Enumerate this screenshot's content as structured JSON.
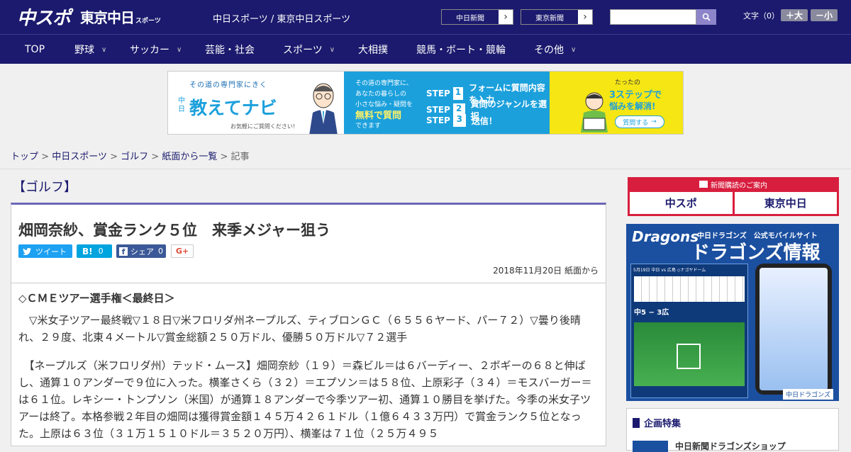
{
  "header": {
    "logo_main": "中スポ",
    "logo_sub": "東京中日",
    "logo_sub_small": "スポーツ",
    "site_title": "中日スポーツ / 東京中日スポーツ",
    "link_chunichi": "中日新聞",
    "link_tokyo": "東京新聞",
    "search_placeholder": "",
    "font_label": "文字（0）",
    "font_large": "＋大",
    "font_small": "－小"
  },
  "nav": {
    "items": [
      "TOP",
      "野球",
      "サッカー",
      "芸能・社会",
      "スポーツ",
      "大相撲",
      "競馬・ボート・競輪",
      "その他"
    ]
  },
  "banner": {
    "left_tagline": "その道の専門家にきく",
    "left_brand_small": "中日",
    "left_brand": "教えてナビ",
    "left_note": "お気軽にご質問ください!",
    "mid_line1": "その道の専門家に、",
    "mid_line2": "あなたの暮らしの",
    "mid_line3": "小さな悩み・疑問を",
    "mid_free": "無料で質問",
    "mid_line4": "できます",
    "step1_label": "STEP",
    "step1_num": "1",
    "step1_text": "フォームに質問内容を入力",
    "step2_label": "STEP",
    "step2_num": "2",
    "step2_text": "質問のジャンルを選択",
    "step3_label": "STEP",
    "step3_num": "3",
    "step3_text": "送信！",
    "right_line1": "たったの",
    "right_line2": "3ステップで",
    "right_line3": "悩みを解消!",
    "right_cta": "質問する"
  },
  "breadcrumb": {
    "top": "トップ",
    "sep": ">",
    "chunichi": "中日スポーツ",
    "golf": "ゴルフ",
    "list": "紙面から一覧",
    "current": "記事"
  },
  "article": {
    "category": "【ゴルフ】",
    "headline": "畑岡奈紗、賞金ランク５位　来季メジャー狙う",
    "share_tweet": "ツイート",
    "share_hatena": "B!",
    "share_hatena_count": "0",
    "share_fb": "シェア",
    "share_fb_count": "0",
    "share_gplus": "G+",
    "date": "2018年11月20日 紙面から",
    "subhead": "◇ＣＭＥツアー選手権＜最終日＞",
    "para1": "　▽米女子ツアー最終戦▽１８日▽米フロリダ州ネープルズ、ティブロンＧＣ（６５５６ヤード、パー７２）▽曇り後晴れ、２９度、北東４メートル▽賞金総額２５０万ドル、優勝５０万ドル▽７２選手",
    "para2": "　【ネープルズ（米フロリダ州）テッド・ムース】畑岡奈紗（１９）＝森ビル＝は６バーディー、２ボギーの６８と伸ばし、通算１０アンダーで９位に入った。横峯さくら（３２）＝エプソン＝は５８位、上原彩子（３４）＝モスバーガー＝は６１位。レキシー・トンプソン（米国）が通算１８アンダーで今季ツアー初、通算１０勝目を挙げた。今季の米女子ツアーは終了。本格参戦２年目の畑岡は獲得賞金額１４５万４２６１ドル（１億６４３３万円）で賞金ランク５位となった。上原は６３位（３１万１５１０ドル＝３５２０万円）、横峯は７１位（２５万４９５"
  },
  "sidebar": {
    "subscribe_title": "新聞購読のご案内",
    "subscribe_chuspo": "中スポ",
    "subscribe_tokyo": "東京中日",
    "dragons_top": "中日ドラゴンズ　公式モバイルサイト",
    "dragons_logo": "Dragons",
    "dragons_title": "ドラゴンズ情報",
    "dragons_score_date": "5月19日 中日 vs 広島 ◇ナゴヤドーム",
    "dragons_score": "中5 − 3広",
    "dragons_footer": "中日ドラゴンズ",
    "feature_title": "企画特集",
    "feature_item": "中日新聞ドラゴンズショップ"
  },
  "colors": {
    "header_bg": "#1b1a6e",
    "accent": "#6b67b6",
    "hatena": "#00a4de",
    "facebook": "#3b5998",
    "twitter": "#1da1f2",
    "subscribe_red": "#d81e3e"
  }
}
